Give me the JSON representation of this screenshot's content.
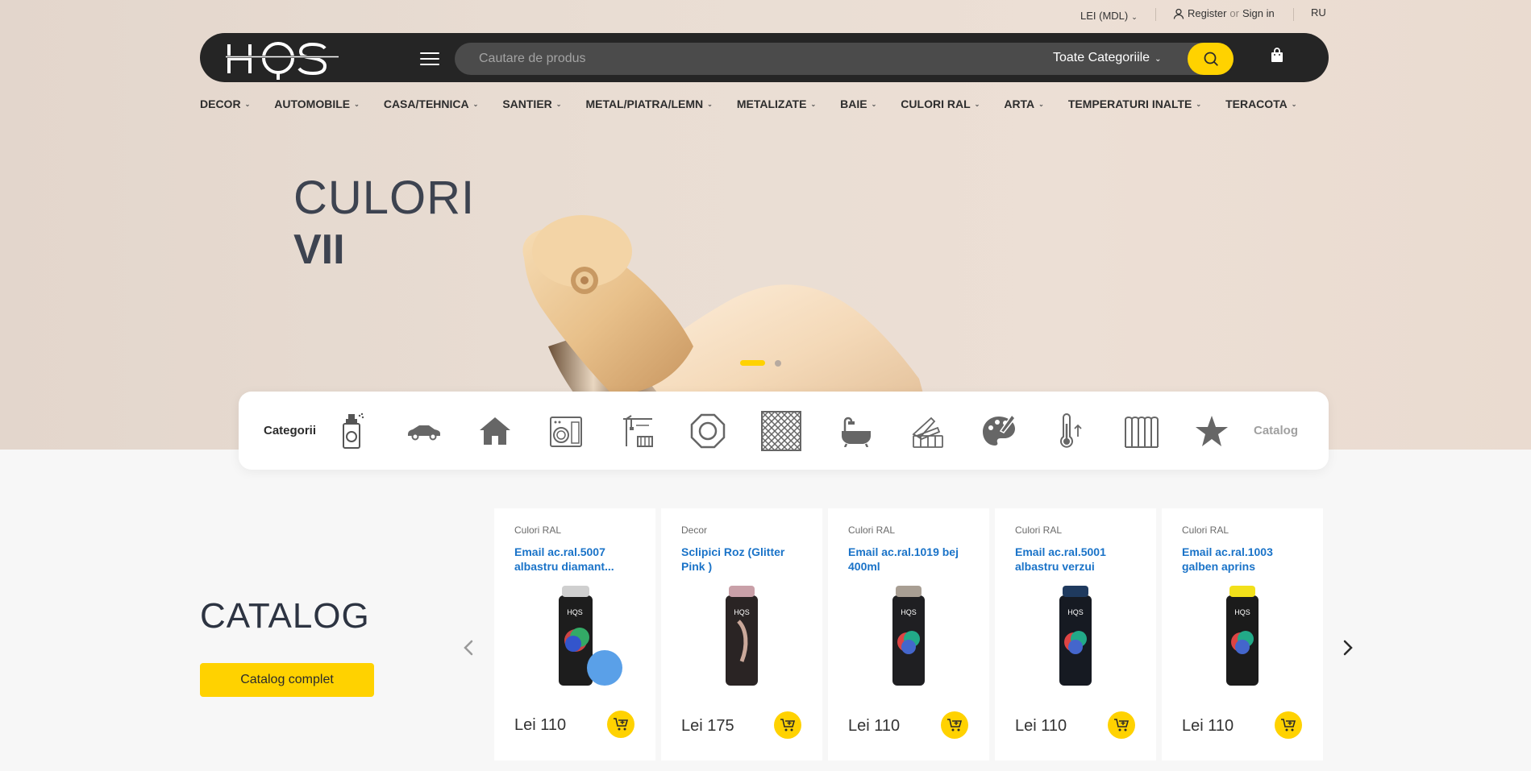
{
  "topbar": {
    "currency": "LEI (MDL)",
    "register": "Register",
    "or": "or",
    "signin": "Sign in",
    "language": "RU"
  },
  "header": {
    "logo_text": "HQS",
    "search_placeholder": "Cautare de produs",
    "category_select": "Toate Categoriile"
  },
  "nav": [
    {
      "label": "DECOR"
    },
    {
      "label": "AUTOMOBILE"
    },
    {
      "label": "CASA/TEHNICA"
    },
    {
      "label": "SANTIER"
    },
    {
      "label": "METAL/PIATRA/LEMN"
    },
    {
      "label": "METALIZATE"
    },
    {
      "label": "BAIE"
    },
    {
      "label": "CULORI RAL"
    },
    {
      "label": "ARTA"
    },
    {
      "label": "TEMPERATURI INALTE"
    },
    {
      "label": "TERACOTA"
    }
  ],
  "hero": {
    "line1": "CULORI",
    "line2": "VII",
    "slides_total": 2,
    "active_slide": 1
  },
  "categories": {
    "title": "Categorii",
    "icons": [
      "spray-can-icon",
      "car-icon",
      "house-icon",
      "appliances-icon",
      "construction-crane-icon",
      "nut-icon",
      "texture-icon",
      "bathtub-icon",
      "color-palette-icon",
      "paint-palette-icon",
      "thermometer-icon",
      "terracotta-tiles-icon",
      "star-icon"
    ],
    "catalog_link": "Catalog"
  },
  "catalog": {
    "title": "CATALOG",
    "button": "Catalog complet",
    "products": [
      {
        "category": "Culori RAL",
        "name": "Email ac.ral.5007 albastru diamant...",
        "price": "Lei 110",
        "cap_color": "#5aa0e8",
        "body_color": "#1d1d1d"
      },
      {
        "category": "Decor",
        "name": "Sclipici Roz (Glitter Pink )",
        "price": "Lei 175",
        "cap_color": "#c9a0a8",
        "body_color": "#2a2424"
      },
      {
        "category": "Culori RAL",
        "name": "Email ac.ral.1019 bej 400ml",
        "price": "Lei 110",
        "cap_color": "#a89e93",
        "body_color": "#1f1f22"
      },
      {
        "category": "Culori RAL",
        "name": "Email ac.ral.5001 albastru verzui",
        "price": "Lei 110",
        "cap_color": "#1f3a5e",
        "body_color": "#161a22"
      },
      {
        "category": "Culori RAL",
        "name": "Email ac.ral.1003 galben aprins",
        "price": "Lei 110",
        "cap_color": "#f2e01a",
        "body_color": "#1b1b1b"
      }
    ]
  },
  "colors": {
    "accent": "#ffd200",
    "header_bg": "#252525",
    "link_blue": "#1a73c8"
  }
}
